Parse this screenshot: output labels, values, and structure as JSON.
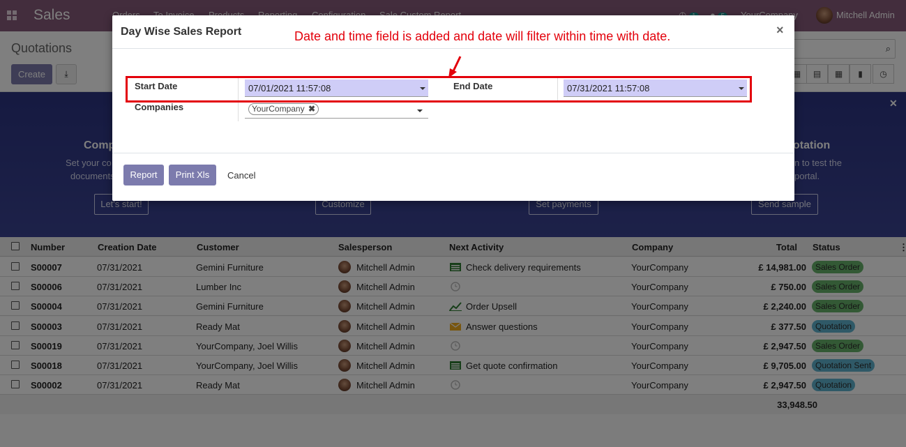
{
  "navbar": {
    "brand": "Sales",
    "menu": [
      "Orders",
      "To Invoice",
      "Products",
      "Reporting",
      "Configuration",
      "Sale Custom Report"
    ],
    "activity_count": "1",
    "message_count": "5",
    "company": "YourCompany",
    "user": "Mitchell Admin"
  },
  "control_panel": {
    "breadcrumb": "Quotations",
    "create_label": "Create"
  },
  "banner": {
    "steps": [
      {
        "title": "Comp",
        "desc1": "Set your co",
        "desc2": "documents",
        "button": "Let's start!"
      },
      {
        "title": "",
        "desc1": "",
        "desc2": "",
        "button": "Customize"
      },
      {
        "title": "",
        "desc1": "",
        "desc2": "",
        "button": "Set payments"
      },
      {
        "title": "otation",
        "desc1": "n to test the",
        "desc2": "portal.",
        "button": "Send sample"
      }
    ]
  },
  "dialog": {
    "title": "Day Wise Sales Report",
    "annotation": "Date and time field is added and date will filter within time with date.",
    "start_date_label": "Start Date",
    "start_date_value": "07/01/2021 11:57:08",
    "end_date_label": "End Date",
    "end_date_value": "07/31/2021 11:57:08",
    "companies_label": "Companies",
    "company_tag": "YourCompany",
    "report_button": "Report",
    "print_xls_button": "Print Xls",
    "cancel_button": "Cancel"
  },
  "table": {
    "headers": [
      "Number",
      "Creation Date",
      "Customer",
      "Salesperson",
      "Next Activity",
      "Company",
      "Total",
      "Status"
    ],
    "rows": [
      {
        "number": "S00007",
        "date": "07/31/2021",
        "customer": "Gemini Furniture",
        "salesperson": "Mitchell Admin",
        "activity": "Check delivery requirements",
        "activity_icon": "todo-icon",
        "company": "YourCompany",
        "total": "£ 14,981.00",
        "status": "Sales Order",
        "status_type": "so"
      },
      {
        "number": "S00006",
        "date": "07/31/2021",
        "customer": "Lumber Inc",
        "salesperson": "Mitchell Admin",
        "activity": "",
        "activity_icon": "clock-icon",
        "company": "YourCompany",
        "total": "£ 750.00",
        "status": "Sales Order",
        "status_type": "so"
      },
      {
        "number": "S00004",
        "date": "07/31/2021",
        "customer": "Gemini Furniture",
        "salesperson": "Mitchell Admin",
        "activity": "Order Upsell",
        "activity_icon": "chart-line-icon",
        "company": "YourCompany",
        "total": "£ 2,240.00",
        "status": "Sales Order",
        "status_type": "so"
      },
      {
        "number": "S00003",
        "date": "07/31/2021",
        "customer": "Ready Mat",
        "salesperson": "Mitchell Admin",
        "activity": "Answer questions",
        "activity_icon": "envelope-icon",
        "company": "YourCompany",
        "total": "£ 377.50",
        "status": "Quotation",
        "status_type": "q"
      },
      {
        "number": "S00019",
        "date": "07/31/2021",
        "customer": "YourCompany, Joel Willis",
        "salesperson": "Mitchell Admin",
        "activity": "",
        "activity_icon": "clock-icon",
        "company": "YourCompany",
        "total": "£ 2,947.50",
        "status": "Sales Order",
        "status_type": "so"
      },
      {
        "number": "S00018",
        "date": "07/31/2021",
        "customer": "YourCompany, Joel Willis",
        "salesperson": "Mitchell Admin",
        "activity": "Get quote confirmation",
        "activity_icon": "todo-icon",
        "company": "YourCompany",
        "total": "£ 9,705.00",
        "status": "Quotation Sent",
        "status_type": "q"
      },
      {
        "number": "S00002",
        "date": "07/31/2021",
        "customer": "Ready Mat",
        "salesperson": "Mitchell Admin",
        "activity": "",
        "activity_icon": "clock-icon",
        "company": "YourCompany",
        "total": "£ 2,947.50",
        "status": "Quotation",
        "status_type": "q"
      }
    ],
    "grand_total": "33,948.50"
  }
}
